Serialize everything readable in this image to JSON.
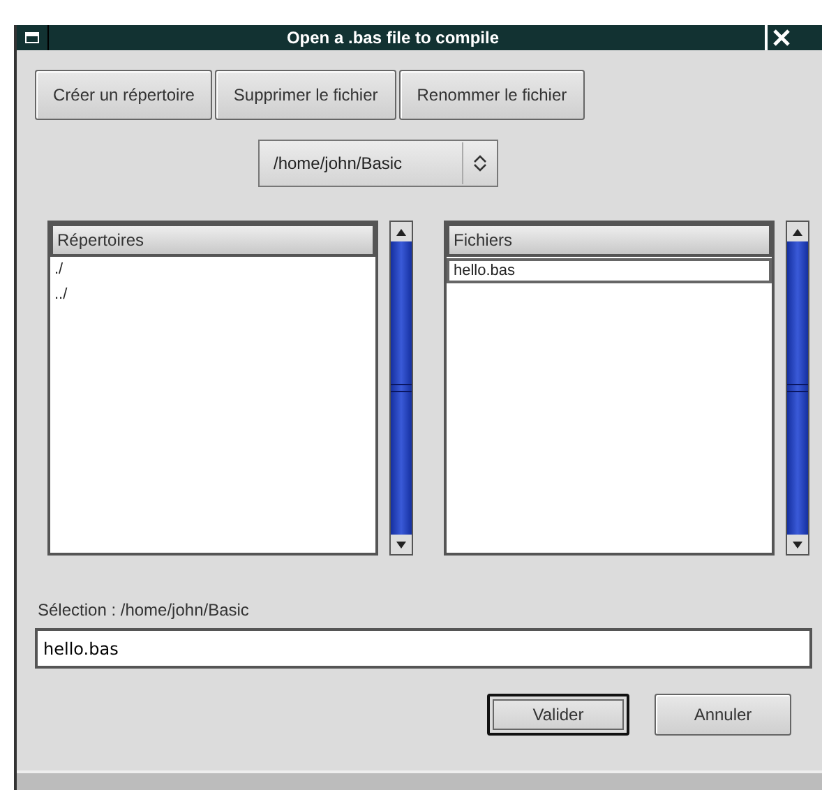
{
  "window": {
    "title": "Open a .bas file to compile"
  },
  "toolbar_buttons": [
    "Créer un répertoire",
    "Supprimer le fichier",
    "Renommer le fichier"
  ],
  "path_dropdown": {
    "value": "/home/john/Basic"
  },
  "directories": {
    "header": "Répertoires",
    "items": [
      {
        "label": "./",
        "selected": false
      },
      {
        "label": "../",
        "selected": false
      }
    ]
  },
  "files": {
    "header": "Fichiers",
    "items": [
      {
        "label": "hello.bas",
        "selected": true
      }
    ]
  },
  "selection_label": "Sélection : /home/john/Basic",
  "selection_field": {
    "value": "hello.bas"
  },
  "buttons": [
    {
      "label": "Valider",
      "default": true
    },
    {
      "label": "Annuler",
      "default": false
    }
  ]
}
